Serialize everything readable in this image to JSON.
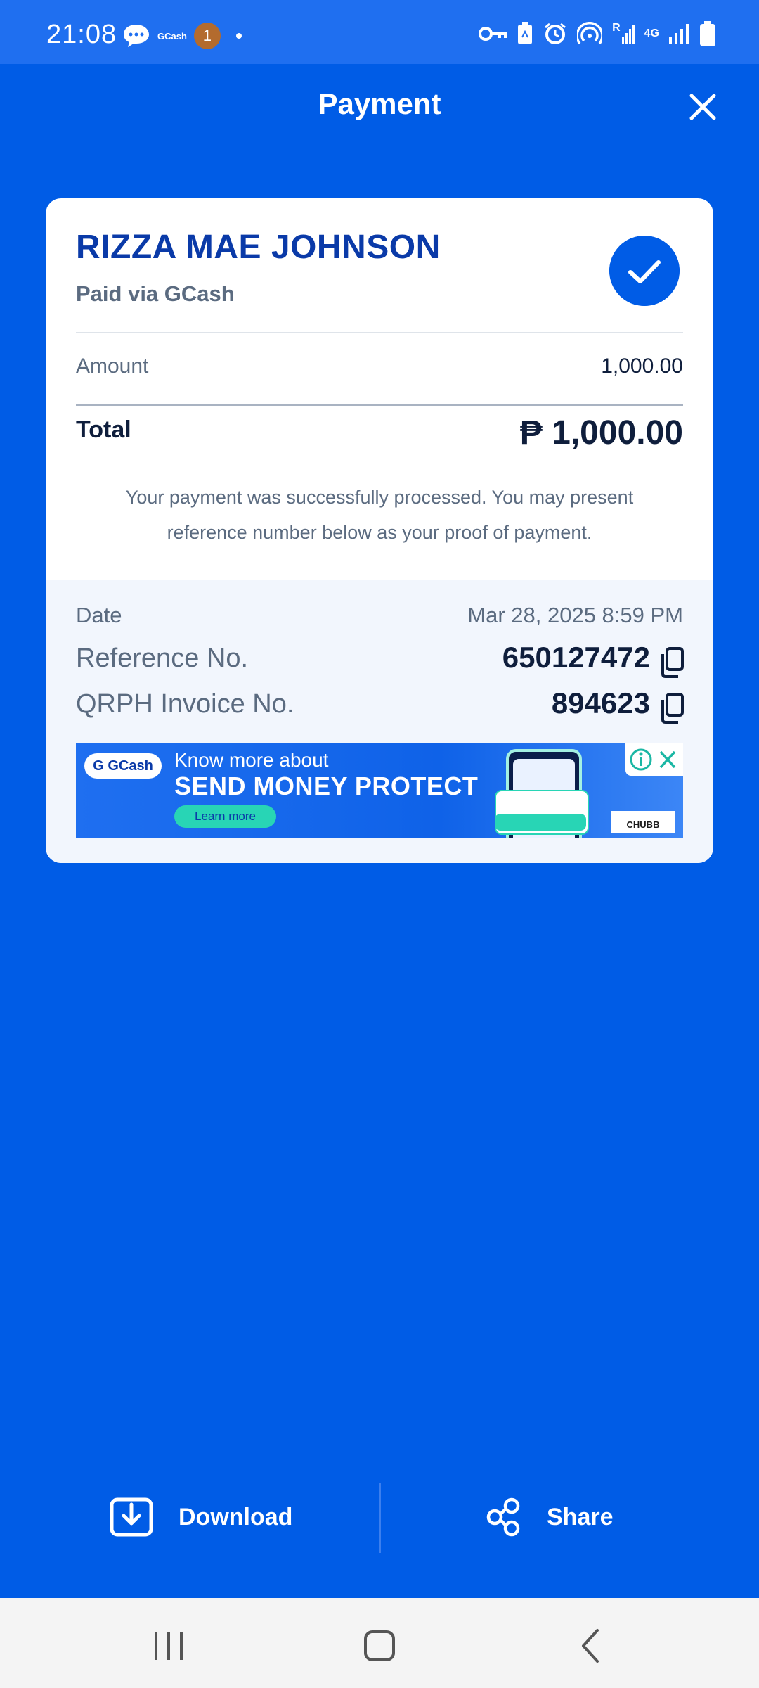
{
  "status_bar": {
    "time": "21:08",
    "left_icons": [
      "chat-bubble-icon",
      "gcash-notification-icon",
      "avatar-notification-icon",
      "dot-icon"
    ],
    "gcash_text": "GCash",
    "avatar_letter": "1",
    "right_icons": [
      "vpn-key-icon",
      "battery-saver-icon",
      "alarm-icon",
      "hotspot-icon",
      "signal-r-icon",
      "signal-4g-icon",
      "signal-icon",
      "battery-icon"
    ],
    "net_r": "R",
    "net_4g": "4G"
  },
  "header": {
    "title": "Payment",
    "close_icon": "close-icon"
  },
  "receipt": {
    "payee": "RIZZA MAE JOHNSON",
    "paid_via": "Paid via GCash",
    "amount_label": "Amount",
    "amount_value": "1,000.00",
    "total_label": "Total",
    "total_value": "₱ 1,000.00",
    "note": "Your payment was successfully processed. You may present reference number below as your proof of payment.",
    "date_label": "Date",
    "date_value": "Mar 28, 2025 8:59 PM",
    "reference_label": "Reference No.",
    "reference_value": "650127472",
    "invoice_label": "QRPH Invoice No.",
    "invoice_value": "894623"
  },
  "banner": {
    "logo": "G GCash",
    "line1": "Know more about",
    "line2": "SEND MONEY PROTECT",
    "cta": "Learn more",
    "sponsor": "CHUBB"
  },
  "actions": {
    "download_label": "Download",
    "share_label": "Share"
  },
  "colors": {
    "background": "#005ce6",
    "status_bar": "#1f6ff0",
    "card": "#ffffff",
    "payee_text": "#0a3aa8",
    "accent_check": "#005ce6"
  }
}
